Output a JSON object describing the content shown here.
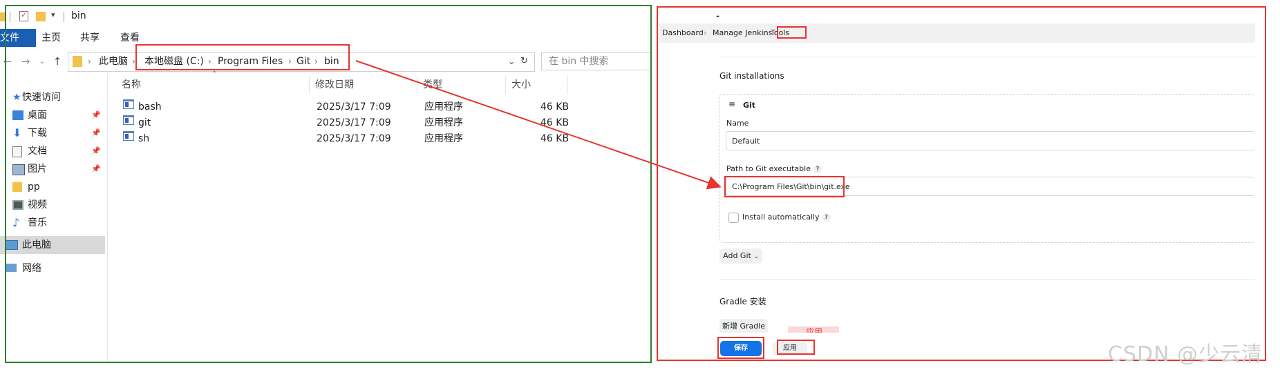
{
  "explorer": {
    "title": "bin",
    "ribbon_tabs": [
      "文件",
      "主页",
      "共享",
      "查看"
    ],
    "address": {
      "root": "此电脑",
      "drive": "本地磁盘 (C:)",
      "folder1": "Program Files",
      "folder2": "Git",
      "folder3": "bin"
    },
    "search_placeholder": "在 bin 中搜索",
    "sidebar": [
      {
        "label": "快速访问",
        "icon": "star-icon"
      },
      {
        "label": "桌面",
        "icon": "desktop-icon"
      },
      {
        "label": "下载",
        "icon": "download-icon"
      },
      {
        "label": "文档",
        "icon": "document-icon"
      },
      {
        "label": "图片",
        "icon": "picture-icon"
      },
      {
        "label": "pp",
        "icon": "folder-icon"
      },
      {
        "label": "视频",
        "icon": "video-icon"
      },
      {
        "label": "音乐",
        "icon": "music-icon"
      },
      {
        "label": "此电脑",
        "icon": "computer-icon"
      },
      {
        "label": "网络",
        "icon": "network-icon"
      }
    ],
    "columns": {
      "name": "名称",
      "date": "修改日期",
      "type": "类型",
      "size": "大小"
    },
    "files": [
      {
        "name": "bash",
        "date": "2025/3/17 7:09",
        "type": "应用程序",
        "size": "46 KB"
      },
      {
        "name": "git",
        "date": "2025/3/17 7:09",
        "type": "应用程序",
        "size": "46 KB"
      },
      {
        "name": "sh",
        "date": "2025/3/17 7:09",
        "type": "应用程序",
        "size": "46 KB"
      }
    ]
  },
  "jenkins": {
    "breadcrumbs": [
      "Dashboard",
      "Manage Jenkins",
      "Tools"
    ],
    "dash": "-",
    "git_section_title": "Git installations",
    "git_block_title": "Git",
    "name_label": "Name",
    "name_value": "Default",
    "path_label": "Path to Git executable",
    "path_value": "C:\\Program Files\\Git\\bin\\git.exe",
    "install_auto_label": "Install automatically",
    "help_glyph": "?",
    "add_git_label": "Add Git",
    "gradle_title": "Gradle 安装",
    "add_gradle_label": "新增 Gradle",
    "apply_overlay": "应用",
    "save_label": "保存",
    "apply_label": "应用"
  },
  "watermark": "CSDN @少云清",
  "colors": {
    "annotation_red": "#e8332e",
    "frame_green": "#2e7d32",
    "save_blue": "#1473e6",
    "ribbon_blue": "#1a5fb4"
  }
}
